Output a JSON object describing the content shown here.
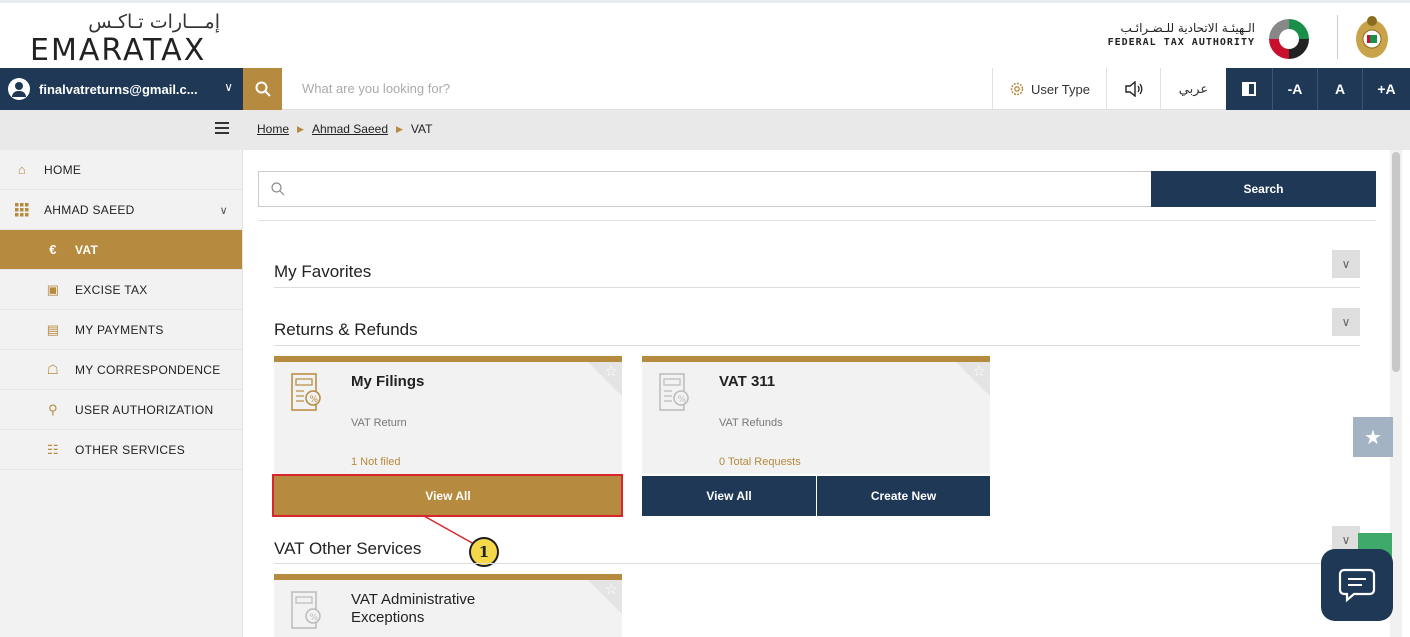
{
  "header": {
    "logo_ar": "إمـــارات تـاكـس",
    "logo_en": "EMARATAX",
    "authority_ar": "الـهيئـة الاتحادية للـضـرائـب",
    "authority_en": "FEDERAL TAX AUTHORITY"
  },
  "topbar": {
    "user_email": "finalvatreturns@gmail.c...",
    "search_placeholder": "What are you looking for?",
    "user_type_label": "User Type",
    "language_label": "عربي",
    "font_decrease": "-A",
    "font_reset": "A",
    "font_increase": "+A"
  },
  "breadcrumb": {
    "items": [
      "Home",
      "Ahmad Saeed",
      "VAT"
    ]
  },
  "sidebar": {
    "items": [
      {
        "label": "HOME",
        "icon": "home-icon"
      },
      {
        "label": "AHMAD SAEED",
        "icon": "grid-icon"
      },
      {
        "label": "VAT",
        "icon": "vat-icon"
      },
      {
        "label": "EXCISE TAX",
        "icon": "excise-icon"
      },
      {
        "label": "MY PAYMENTS",
        "icon": "payments-icon"
      },
      {
        "label": "MY CORRESPONDENCE",
        "icon": "correspondence-icon"
      },
      {
        "label": "USER AUTHORIZATION",
        "icon": "user-auth-icon"
      },
      {
        "label": "OTHER SERVICES",
        "icon": "other-services-icon"
      }
    ]
  },
  "main": {
    "search_button": "Search",
    "sections": {
      "favorites": "My Favorites",
      "returns": "Returns & Refunds",
      "other_services": "VAT Other Services"
    },
    "cards": {
      "my_filings": {
        "title": "My Filings",
        "subtitle": "VAT Return",
        "stat": "1 Not filed",
        "btn_view_all": "View All"
      },
      "vat311": {
        "title": "VAT 311",
        "subtitle": "VAT Refunds",
        "stat": "0 Total Requests",
        "btn_view_all": "View All",
        "btn_create_new": "Create New"
      },
      "vat_admin": {
        "title": "VAT Administrative Exceptions"
      }
    },
    "callout_number": "1"
  },
  "colors": {
    "navy": "#1e3856",
    "gold": "#b68a3f",
    "highlight_red": "#d9262c",
    "callout_yellow": "#f5d84a"
  }
}
